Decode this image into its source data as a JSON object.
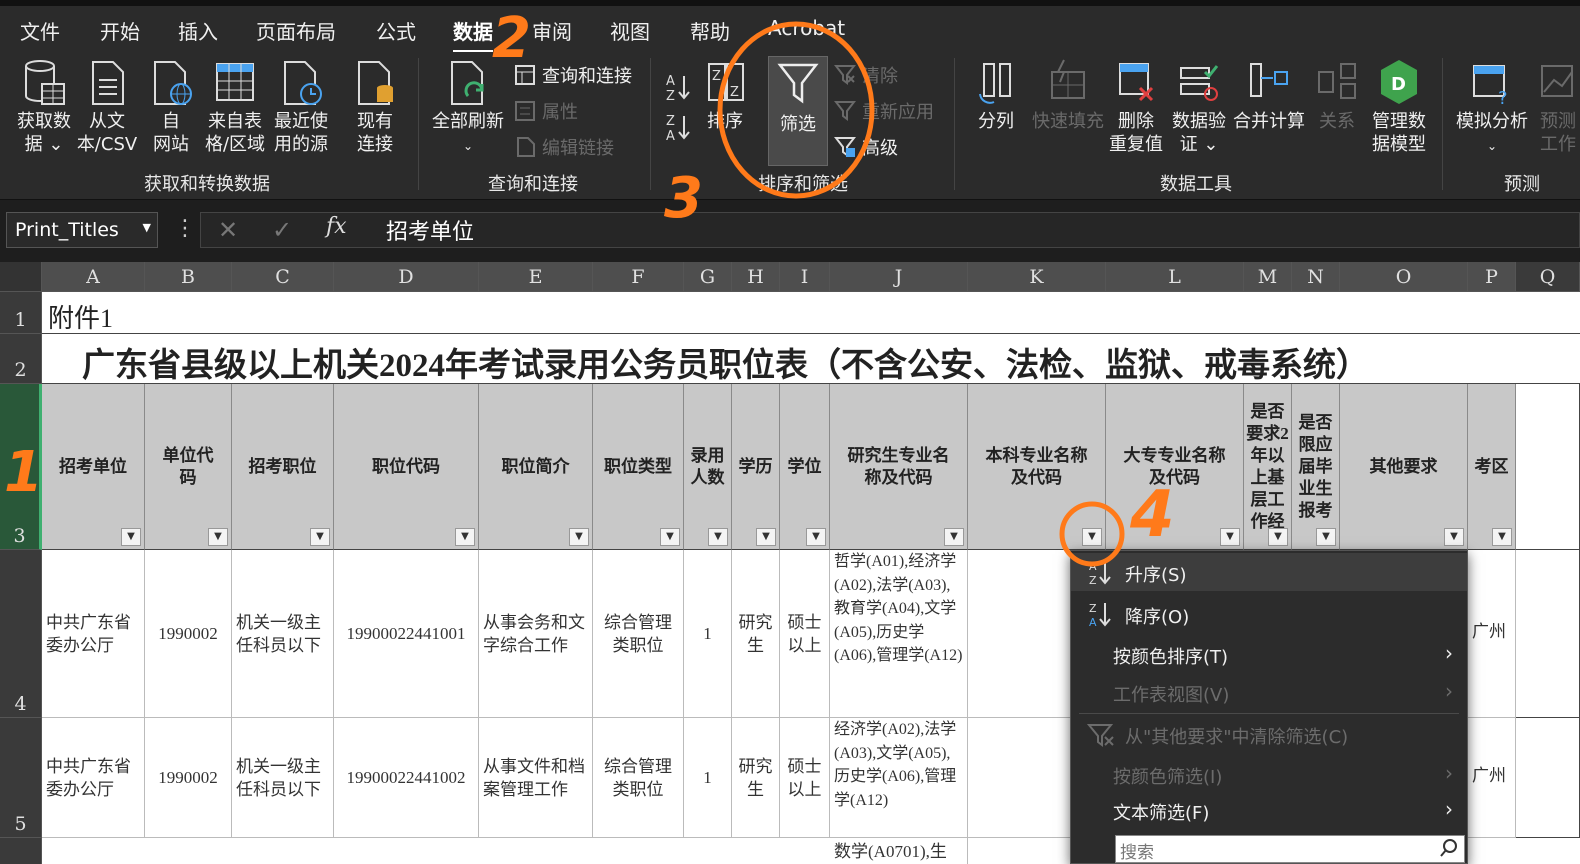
{
  "menu": {
    "tabs": [
      "文件",
      "开始",
      "插入",
      "页面布局",
      "公式",
      "数据",
      "审阅",
      "视图",
      "帮助",
      "Acrobat"
    ],
    "active": "数据"
  },
  "ribbon": {
    "get_data": {
      "l1": "获取数",
      "l2": "据 ⌄"
    },
    "from_text": {
      "l1": "从文",
      "l2": "本/CSV"
    },
    "from_web": {
      "l1": "自",
      "l2": "网站"
    },
    "from_table": {
      "l1": "来自表",
      "l2": "格/区域"
    },
    "recent": {
      "l1": "最近使",
      "l2": "用的源"
    },
    "existing": {
      "l1": "现有",
      "l2": "连接"
    },
    "group1": "获取和转换数据",
    "refresh_all": {
      "l1": "全部刷新",
      "l2": "⌄"
    },
    "queries": "查询和连接",
    "properties": "属性",
    "edit_links": "编辑链接",
    "group2": "查询和连接",
    "sort": "排序",
    "filter": "筛选",
    "clear": "清除",
    "reapply": "重新应用",
    "advanced": "高级",
    "group3": "排序和筛选",
    "text_to_columns": "分列",
    "flash_fill": "快速填充",
    "remove_dup": {
      "l1": "删除",
      "l2": "重复值"
    },
    "validation": {
      "l1": "数据验",
      "l2": "证 ⌄"
    },
    "consolidate": "合并计算",
    "relations": "关系",
    "data_model": {
      "l1": "管理数",
      "l2": "据模型"
    },
    "group4": "数据工具",
    "what_if": {
      "l1": "模拟分析",
      "l2": "⌄"
    },
    "forecast": {
      "l1": "预测",
      "l2": "工作"
    },
    "group5": "预测"
  },
  "formula_bar": {
    "name_box": "Print_Titles",
    "formula": "招考单位"
  },
  "columns": [
    "A",
    "B",
    "C",
    "D",
    "E",
    "F",
    "G",
    "H",
    "I",
    "J",
    "K",
    "L",
    "M",
    "N",
    "O",
    "P",
    "Q"
  ],
  "rows": {
    "r1": {
      "num": "1",
      "a": "附件1"
    },
    "r2": {
      "num": "2",
      "title": "广东省县级以上机关2024年考试录用公务员职位表（不含公安、法检、监狱、戒毒系统）"
    },
    "r3": {
      "num": "3",
      "headers": [
        "招考单位",
        "单位代码",
        "招考职位",
        "职位代码",
        "职位简介",
        "职位类型",
        "录用人数",
        "学历",
        "学位",
        "研究生专业名称及代码",
        "本科专业名称及代码",
        "大专专业名称及代码",
        "是否要求2年以上基层工作经",
        "是否限应届毕业生报考",
        "其他要求",
        "考区"
      ]
    },
    "r4": {
      "num": "4",
      "cells": [
        "中共广东省委办公厅",
        "1990002",
        "机关一级主任科员以下",
        "19900022441001",
        "从事会务和文字综合工作",
        "综合管理类职位",
        "1",
        "研究生",
        "硕士以上",
        "哲学(A01),经济学(A02),法学(A03),教育学(A04),文学(A05),历史学(A06),管理学(A12)",
        "广州"
      ]
    },
    "r5": {
      "num": "5",
      "cells": [
        "中共广东省委办公厅",
        "1990002",
        "机关一级主任科员以下",
        "19900022441002",
        "从事文件和档案管理工作",
        "综合管理类职位",
        "1",
        "研究生",
        "硕士以上",
        "经济学(A02),法学(A03),文学(A05),历史学(A06),管理学(A12)",
        "广州"
      ]
    },
    "r6": {
      "j": "数学(A0701),生"
    }
  },
  "filter_menu": {
    "items": [
      "升序(S)",
      "降序(O)",
      "按颜色排序(T)",
      "工作表视图(V)",
      "从\"其他要求\"中清除筛选(C)",
      "按颜色筛选(I)",
      "文本筛选(F)"
    ],
    "search_placeholder": "搜索"
  },
  "annotations": [
    "1",
    "2",
    "3",
    "4"
  ]
}
